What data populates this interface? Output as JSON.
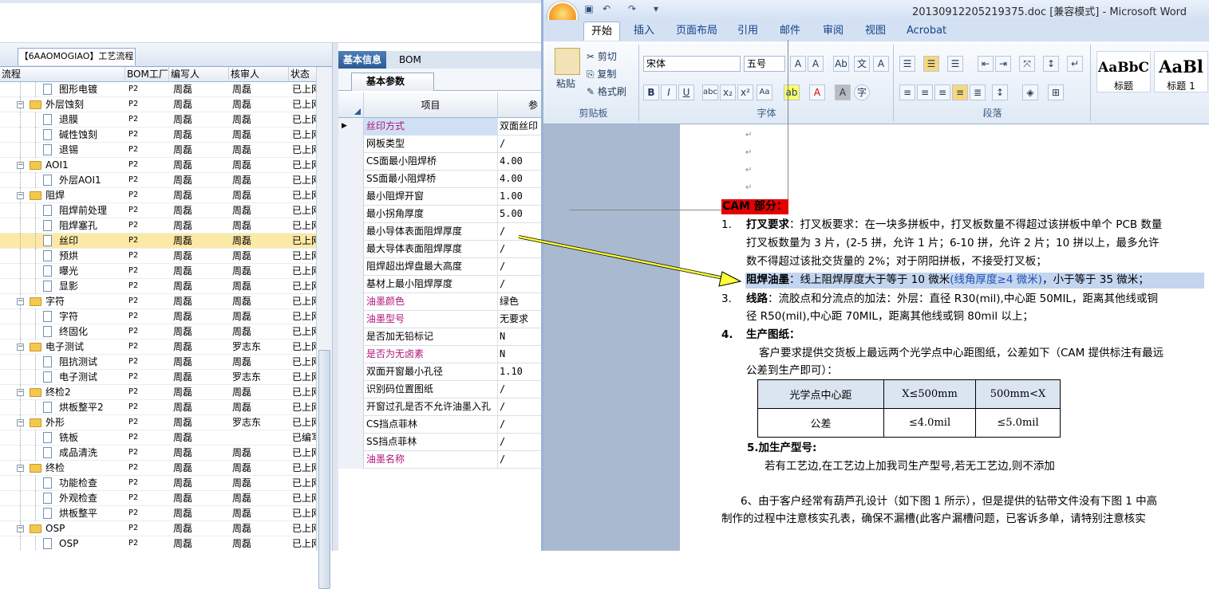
{
  "left_app": {
    "proc_tab_label": "【6AAOMOGIAO】工艺流程",
    "tree_headers": [
      "流程",
      "BOM工厂",
      "编写人",
      "核审人",
      "状态"
    ],
    "tree_rows": [
      {
        "name": "图形电镀",
        "level": 2,
        "type": "file",
        "bom": "P2",
        "writer": "周磊",
        "reviewer": "周磊",
        "status": "已上网"
      },
      {
        "name": "外层蚀刻",
        "level": 1,
        "type": "folder",
        "bom": "P2",
        "writer": "周磊",
        "reviewer": "周磊",
        "status": "已上网"
      },
      {
        "name": "退膜",
        "level": 2,
        "type": "file",
        "bom": "P2",
        "writer": "周磊",
        "reviewer": "周磊",
        "status": "已上网"
      },
      {
        "name": "碱性蚀刻",
        "level": 2,
        "type": "file",
        "bom": "P2",
        "writer": "周磊",
        "reviewer": "周磊",
        "status": "已上网"
      },
      {
        "name": "退锡",
        "level": 2,
        "type": "file",
        "bom": "P2",
        "writer": "周磊",
        "reviewer": "周磊",
        "status": "已上网"
      },
      {
        "name": "AOI1",
        "level": 1,
        "type": "folder",
        "bom": "P2",
        "writer": "周磊",
        "reviewer": "周磊",
        "status": "已上网"
      },
      {
        "name": "外层AOI1",
        "level": 2,
        "type": "file",
        "bom": "P2",
        "writer": "周磊",
        "reviewer": "周磊",
        "status": "已上网"
      },
      {
        "name": "阻焊",
        "level": 1,
        "type": "folder",
        "bom": "P2",
        "writer": "周磊",
        "reviewer": "周磊",
        "status": "已上网"
      },
      {
        "name": "阻焊前处理",
        "level": 2,
        "type": "file",
        "bom": "P2",
        "writer": "周磊",
        "reviewer": "周磊",
        "status": "已上网"
      },
      {
        "name": "阻焊塞孔",
        "level": 2,
        "type": "file",
        "bom": "P2",
        "writer": "周磊",
        "reviewer": "周磊",
        "status": "已上网"
      },
      {
        "name": "丝印",
        "level": 2,
        "type": "file",
        "bom": "P2",
        "writer": "周磊",
        "reviewer": "周磊",
        "status": "已上网",
        "selected": true
      },
      {
        "name": "预烘",
        "level": 2,
        "type": "file",
        "bom": "P2",
        "writer": "周磊",
        "reviewer": "周磊",
        "status": "已上网"
      },
      {
        "name": "曝光",
        "level": 2,
        "type": "file",
        "bom": "P2",
        "writer": "周磊",
        "reviewer": "周磊",
        "status": "已上网"
      },
      {
        "name": "显影",
        "level": 2,
        "type": "file",
        "bom": "P2",
        "writer": "周磊",
        "reviewer": "周磊",
        "status": "已上网"
      },
      {
        "name": "字符",
        "level": 1,
        "type": "folder",
        "bom": "P2",
        "writer": "周磊",
        "reviewer": "周磊",
        "status": "已上网"
      },
      {
        "name": "字符",
        "level": 2,
        "type": "file",
        "bom": "P2",
        "writer": "周磊",
        "reviewer": "周磊",
        "status": "已上网"
      },
      {
        "name": "终固化",
        "level": 2,
        "type": "file",
        "bom": "P2",
        "writer": "周磊",
        "reviewer": "周磊",
        "status": "已上网"
      },
      {
        "name": "电子测试",
        "level": 1,
        "type": "folder",
        "bom": "P2",
        "writer": "周磊",
        "reviewer": "罗志东",
        "status": "已上网"
      },
      {
        "name": "阻抗测试",
        "level": 2,
        "type": "file",
        "bom": "P2",
        "writer": "周磊",
        "reviewer": "周磊",
        "status": "已上网"
      },
      {
        "name": "电子测试",
        "level": 2,
        "type": "file",
        "bom": "P2",
        "writer": "周磊",
        "reviewer": "罗志东",
        "status": "已上网"
      },
      {
        "name": "终检2",
        "level": 1,
        "type": "folder",
        "bom": "P2",
        "writer": "周磊",
        "reviewer": "周磊",
        "status": "已上网"
      },
      {
        "name": "烘板整平2",
        "level": 2,
        "type": "file",
        "bom": "P2",
        "writer": "周磊",
        "reviewer": "周磊",
        "status": "已上网"
      },
      {
        "name": "外形",
        "level": 1,
        "type": "folder",
        "bom": "P2",
        "writer": "周磊",
        "reviewer": "罗志东",
        "status": "已上网"
      },
      {
        "name": "铣板",
        "level": 2,
        "type": "file",
        "bom": "P2",
        "writer": "周磊",
        "reviewer": "",
        "status": "已编写"
      },
      {
        "name": "成品清洗",
        "level": 2,
        "type": "file",
        "bom": "P2",
        "writer": "周磊",
        "reviewer": "周磊",
        "status": "已上网"
      },
      {
        "name": "终检",
        "level": 1,
        "type": "folder",
        "bom": "P2",
        "writer": "周磊",
        "reviewer": "周磊",
        "status": "已上网"
      },
      {
        "name": "功能检查",
        "level": 2,
        "type": "file",
        "bom": "P2",
        "writer": "周磊",
        "reviewer": "周磊",
        "status": "已上网"
      },
      {
        "name": "外观检查",
        "level": 2,
        "type": "file",
        "bom": "P2",
        "writer": "周磊",
        "reviewer": "周磊",
        "status": "已上网"
      },
      {
        "name": "烘板整平",
        "level": 2,
        "type": "file",
        "bom": "P2",
        "writer": "周磊",
        "reviewer": "周磊",
        "status": "已上网"
      },
      {
        "name": "OSP",
        "level": 1,
        "type": "folder",
        "bom": "P2",
        "writer": "周磊",
        "reviewer": "周磊",
        "status": "已上网"
      },
      {
        "name": "OSP",
        "level": 2,
        "type": "file",
        "bom": "P2",
        "writer": "周磊",
        "reviewer": "周磊",
        "status": "已上网"
      }
    ],
    "right_tabs": [
      "基本信息",
      "BOM"
    ],
    "sub_tab": "基本参数",
    "grid_header_item": "项目",
    "grid_header_value": "参",
    "grid_rows": [
      {
        "item": "丝印方式",
        "value": "双面丝印",
        "pink": true,
        "selected": true
      },
      {
        "item": "网板类型",
        "value": "/"
      },
      {
        "item": "CS面最小阻焊桥",
        "value": "4.00"
      },
      {
        "item": "SS面最小阻焊桥",
        "value": "4.00"
      },
      {
        "item": "最小阻焊开窗",
        "value": "1.00"
      },
      {
        "item": "最小拐角厚度",
        "value": "5.00"
      },
      {
        "item": "最小导体表面阻焊厚度",
        "value": "/"
      },
      {
        "item": "最大导体表面阻焊厚度",
        "value": "/"
      },
      {
        "item": "阻焊超出焊盘最大高度",
        "value": "/"
      },
      {
        "item": "基材上最小阻焊厚度",
        "value": "/"
      },
      {
        "item": "油墨颜色",
        "value": "绿色",
        "pink": true
      },
      {
        "item": "油墨型号",
        "value": "无要求",
        "pink": true
      },
      {
        "item": "是否加无铅标记",
        "value": "N"
      },
      {
        "item": "是否为无卤素",
        "value": "N",
        "pink": true
      },
      {
        "item": "双面开窗最小孔径",
        "value": "1.10"
      },
      {
        "item": "识别码位置图纸",
        "value": "/"
      },
      {
        "item": "开窗过孔是否不允许油墨入孔",
        "value": "/"
      },
      {
        "item": "CS挡点菲林",
        "value": "/"
      },
      {
        "item": "SS挡点菲林",
        "value": "/"
      },
      {
        "item": "油墨名称",
        "value": "/",
        "pink": true
      }
    ]
  },
  "word": {
    "title": "20130912205219375.doc [兼容模式] - Microsoft Word",
    "tabs": [
      "开始",
      "插入",
      "页面布局",
      "引用",
      "邮件",
      "审阅",
      "视图",
      "Acrobat"
    ],
    "clipboard": {
      "paste": "粘贴",
      "cut": "剪切",
      "copy": "复制",
      "format_painter": "格式刷",
      "label": "剪贴板"
    },
    "font": {
      "name": "宋体",
      "size": "五号",
      "label": "字体"
    },
    "paragraph_label": "段落",
    "styles": [
      {
        "sample": "AaBbC",
        "name": "标题"
      },
      {
        "sample": "AaBl",
        "name": "标题 1"
      }
    ],
    "doc": {
      "cam_title": "CAM 部分：",
      "item1_label": "打叉要求",
      "item1_line1": "：打叉板要求：在一块多拼板中，打叉板数量不得超过该拼板中单个 PCB 数量",
      "item1_line2": "打叉板数量为 3 片，(2-5 拼，允许 1 片；6-10 拼，允许 2 片；10 拼以上，最多允许",
      "item1_line3": "数不得超过该批交货量的 2%；对于阴阳拼板，不接受打叉板；",
      "item2_label": "阻焊油墨",
      "item2_text": "：线上阻焊厚度大于等于 10 微米",
      "item2_blue": "(线角厚度≥4 微米)",
      "item2_tail": "，小于等于 35 微米；",
      "item3_label": "线路",
      "item3_line1": "：流胶点和分流点的加法：外层：直径 R30(mil),中心距 50MIL，距离其他线或铜",
      "item3_line2": "径 R50(mil),中心距 70MIL，距离其他线或铜 80mil 以上；",
      "item4_label": "生产图纸：",
      "item4_line1": "客户要求提供交货板上最远两个光学点中心距图纸，公差如下（CAM 提供标注有最远",
      "item4_line2": "公差到生产即可）：",
      "table_headers": [
        "光学点中心距",
        "X≤500mm",
        "500mm<X"
      ],
      "table_row": [
        "公差",
        "≤4.0mil",
        "≤5.0mil"
      ],
      "item5_label": "5.加生产型号:",
      "item5_text": "若有工艺边,在工艺边上加我司生产型号,若无工艺边,则不添加",
      "item6_line1": "6、由于客户经常有葫芦孔设计（如下图 1 所示），但是提供的钻带文件没有下图 1 中高",
      "item6_line2": "制作的过程中注意核实孔表，确保不漏槽(此客户漏槽问题，已客诉多单，请特别注意核实",
      "numbers": [
        "1.",
        "2.",
        "3.",
        "4."
      ]
    }
  }
}
